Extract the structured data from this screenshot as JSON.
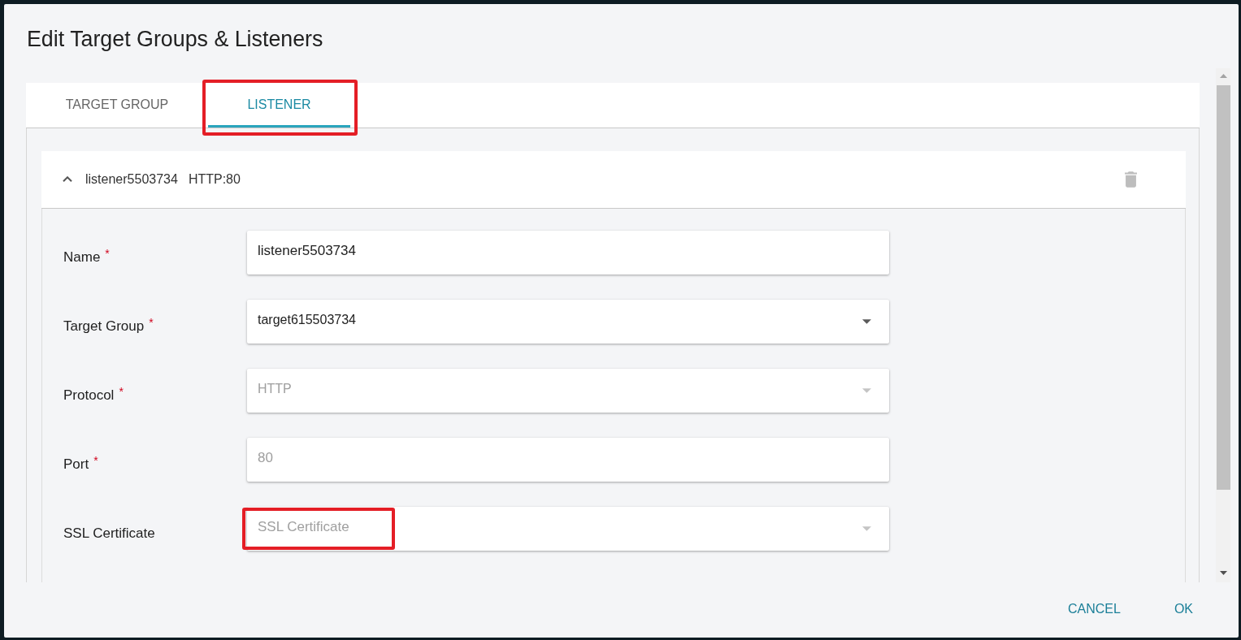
{
  "dialog": {
    "title": "Edit Target Groups & Listeners"
  },
  "tabs": [
    {
      "label": "TARGET GROUP",
      "selected": false,
      "highlighted": false
    },
    {
      "label": "LISTENER",
      "selected": true,
      "highlighted": true
    }
  ],
  "listeners": [
    {
      "expanded": true,
      "name": "listener5503734",
      "summary": "HTTP:80",
      "fields": [
        {
          "kind": "text",
          "label": "Name",
          "required_mark": "*",
          "value": "listener5503734",
          "disabled": false,
          "highlighted": false
        },
        {
          "kind": "select",
          "label": "Target Group",
          "required_mark": "*",
          "value": "target615503734",
          "disabled": false,
          "highlighted": false
        },
        {
          "kind": "select",
          "label": "Protocol",
          "required_mark": "*",
          "value": "HTTP",
          "disabled": true,
          "highlighted": false
        },
        {
          "kind": "text",
          "label": "Port",
          "required_mark": "*",
          "value": "80",
          "disabled": true,
          "highlighted": false
        },
        {
          "kind": "select",
          "label": "SSL Certificate",
          "placeholder": "SSL Certificate",
          "disabled": true,
          "highlighted": true
        }
      ]
    }
  ],
  "buttons": [
    {
      "label": "CANCEL"
    },
    {
      "label": "OK"
    }
  ]
}
